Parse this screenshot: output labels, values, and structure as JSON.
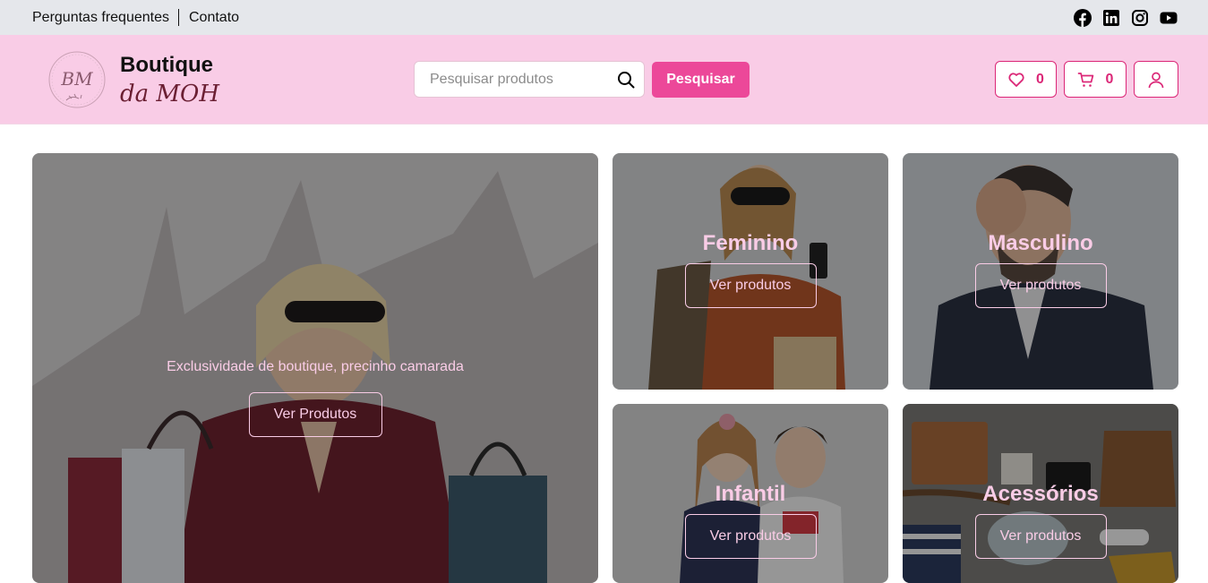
{
  "topbar": {
    "faq_label": "Perguntas frequentes",
    "contact_label": "Contato",
    "social": [
      "facebook-icon",
      "linkedin-icon",
      "instagram-icon",
      "youtube-icon"
    ]
  },
  "header": {
    "logo_mark": "BM",
    "logo_line1": "Boutique",
    "logo_line2": "da MOH",
    "search_placeholder": "Pesquisar produtos",
    "search_value": "",
    "search_button": "Pesquisar",
    "wishlist_count": "0",
    "cart_count": "0"
  },
  "hero": {
    "text": "Exclusividade de boutique, precinho camarada",
    "button": "Ver Produtos"
  },
  "categories": [
    {
      "title": "Feminino",
      "button": "Ver produtos"
    },
    {
      "title": "Masculino",
      "button": "Ver produtos"
    },
    {
      "title": "Infantil",
      "button": "Ver produtos"
    },
    {
      "title": "Acessórios",
      "button": "Ver produtos"
    }
  ],
  "colors": {
    "accent": "#ec4899",
    "accent_dark": "#db2777",
    "header_bg": "#f9cce6",
    "topbar_bg": "#e5e7eb"
  }
}
